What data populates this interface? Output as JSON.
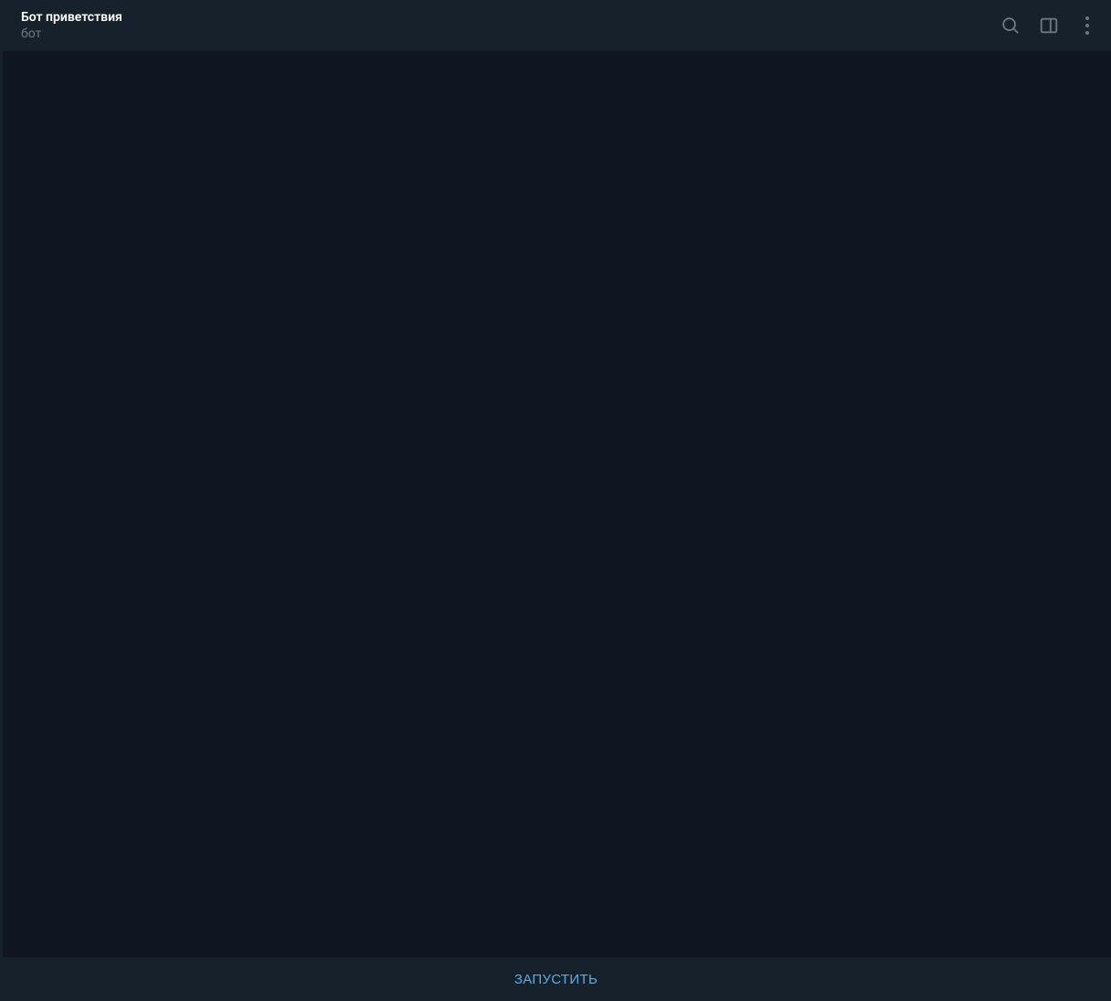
{
  "header": {
    "title": "Бот приветствия",
    "subtitle": "бот"
  },
  "footer": {
    "start_label": "ЗАПУСТИТЬ"
  },
  "icons": {
    "search": "search-icon",
    "sidepanel": "sidepanel-icon",
    "more": "more-options-icon"
  }
}
